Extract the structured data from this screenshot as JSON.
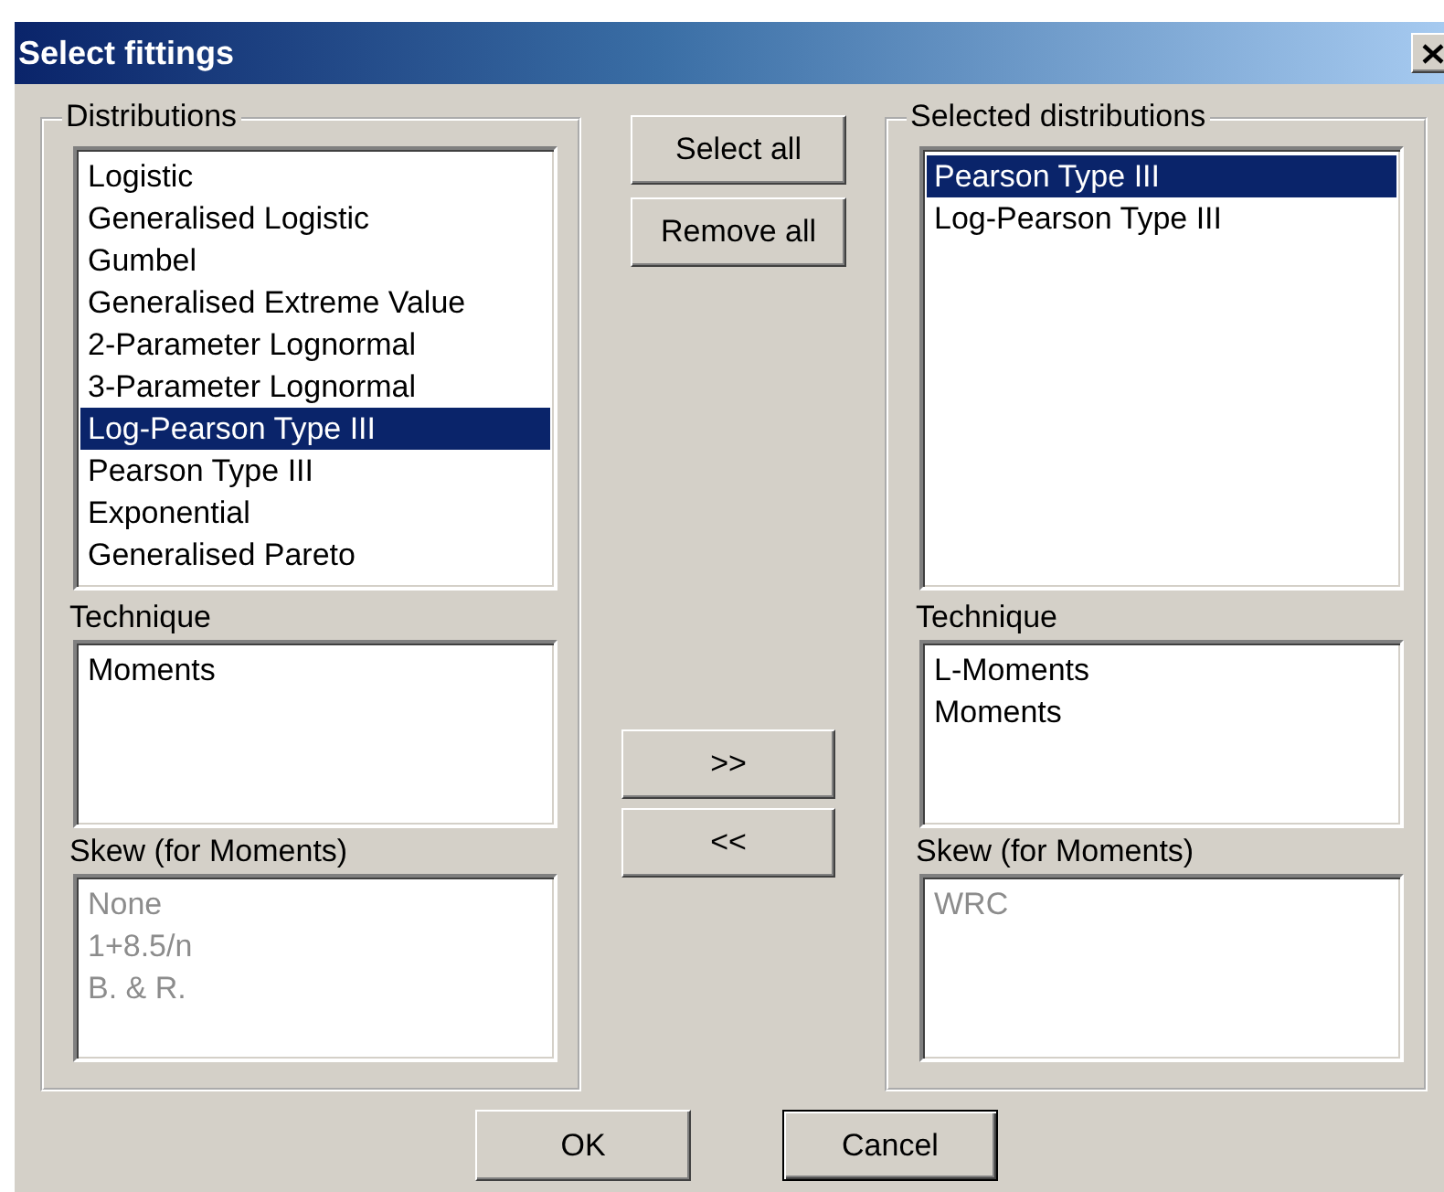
{
  "window": {
    "title": "Select fittings"
  },
  "left_panel": {
    "label": "Distributions",
    "distributions": {
      "items": [
        {
          "label": "Logistic",
          "selected": false
        },
        {
          "label": "Generalised Logistic",
          "selected": false
        },
        {
          "label": "Gumbel",
          "selected": false
        },
        {
          "label": "Generalised Extreme Value",
          "selected": false
        },
        {
          "label": "2-Parameter Lognormal",
          "selected": false
        },
        {
          "label": "3-Parameter Lognormal",
          "selected": false
        },
        {
          "label": "Log-Pearson Type III",
          "selected": true
        },
        {
          "label": "Pearson Type III",
          "selected": false
        },
        {
          "label": "Exponential",
          "selected": false
        },
        {
          "label": "Generalised Pareto",
          "selected": false
        }
      ]
    },
    "technique": {
      "label": "Technique",
      "items": [
        {
          "label": "Moments",
          "selected": false
        }
      ]
    },
    "skew": {
      "label": "Skew (for Moments)",
      "disabled": true,
      "items": [
        {
          "label": "None",
          "selected": false
        },
        {
          "label": "1+8.5/n",
          "selected": false
        },
        {
          "label": "B. & R.",
          "selected": false
        }
      ]
    }
  },
  "middle_buttons": [
    {
      "label": "Select all"
    },
    {
      "label": "Remove all"
    },
    {
      "label": ">>"
    },
    {
      "label": "<<"
    }
  ],
  "right_panel": {
    "label": "Selected distributions",
    "distributions": {
      "items": [
        {
          "label": "Pearson Type III",
          "selected": true
        },
        {
          "label": "Log-Pearson Type III",
          "selected": false
        }
      ]
    },
    "technique": {
      "label": "Technique",
      "items": [
        {
          "label": "L-Moments",
          "selected": false
        },
        {
          "label": "Moments",
          "selected": false
        }
      ]
    },
    "skew": {
      "label": "Skew (for Moments)",
      "disabled": true,
      "items": [
        {
          "label": "WRC",
          "selected": false
        }
      ]
    }
  },
  "buttons": [
    {
      "label": "OK",
      "default": false
    },
    {
      "label": "Cancel",
      "default": true
    }
  ]
}
